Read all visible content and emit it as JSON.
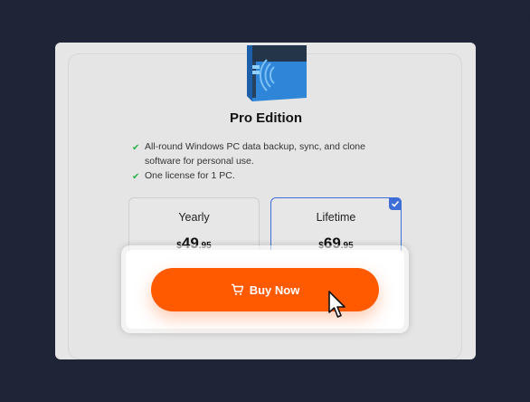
{
  "product": {
    "title": "Pro Edition",
    "box_icon": "product-box-icon"
  },
  "features": [
    "All-round Windows PC data backup, sync, and clone software for personal use.",
    "One license for 1 PC."
  ],
  "plans": [
    {
      "name": "Yearly",
      "currency": "$",
      "price_int": "49",
      "price_dec": ".95",
      "selected": false
    },
    {
      "name": "Lifetime",
      "currency": "$",
      "price_int": "69",
      "price_dec": ".95",
      "selected": true
    }
  ],
  "buy_button": {
    "label": "Buy Now",
    "icon": "cart-icon"
  },
  "colors": {
    "accent": "#ff5a00",
    "selected_border": "#3f6fd6",
    "check": "#2bb24c",
    "background": "#1f2536"
  }
}
